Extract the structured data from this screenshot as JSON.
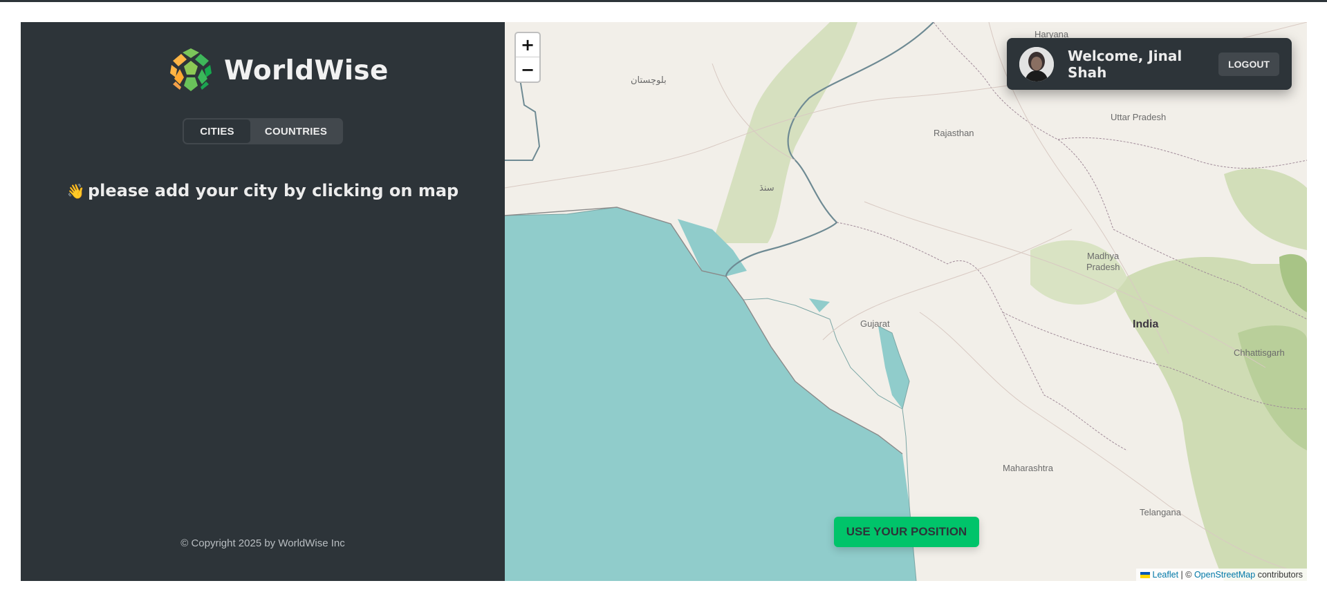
{
  "app": {
    "name": "WorldWise"
  },
  "sidebar": {
    "tabs": [
      {
        "label": "CITIES",
        "active": true
      },
      {
        "label": "COUNTRIES",
        "active": false
      }
    ],
    "message_emoji": "👋",
    "message": "please add your city by clicking on map",
    "copyright": "© Copyright 2025 by WorldWise Inc"
  },
  "user": {
    "welcome": "Welcome, Jinal Shah",
    "logout_label": "LOGOUT",
    "avatar": "user-avatar"
  },
  "map": {
    "zoom_in": "+",
    "zoom_out": "−",
    "position_button": "USE YOUR POSITION",
    "labels": {
      "balochistan": "بلوچستان",
      "sindh": "سنڌ",
      "rajasthan": "Rajasthan",
      "haryana": "Haryana",
      "uttar_pradesh": "Uttar Pradesh",
      "madhya": "Madhya",
      "pradesh": "Pradesh",
      "gujarat": "Gujarat",
      "india": "India",
      "chhattisgarh": "Chhattisgarh",
      "maharashtra": "Maharashtra",
      "telangana": "Telangana"
    },
    "attribution": {
      "leaflet": "Leaflet",
      "separator": "| ©",
      "osm": "OpenStreetMap",
      "suffix": "contributors"
    }
  },
  "colors": {
    "sidebar_bg": "#2d3439",
    "tab_bg": "#42484d",
    "brand_green": "#00c46a",
    "sea": "#90cccb",
    "land": "#f2efe9",
    "vegetation": "#c9d9ae"
  }
}
